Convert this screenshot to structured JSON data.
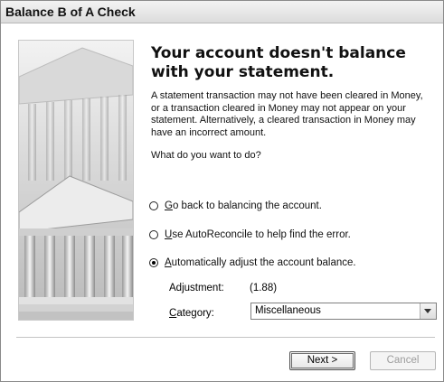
{
  "window": {
    "title": "Balance B of A Check"
  },
  "header": {
    "heading": "Your account doesn't balance with your statement."
  },
  "body": {
    "description": "A statement transaction may not have been cleared in Money, or a transaction cleared in Money may not appear on your statement. Alternatively, a cleared transaction in Money may have an incorrect amount.",
    "question": "What do you want to do?"
  },
  "options": [
    {
      "mnemonic": "G",
      "rest": "o back to balancing the account.",
      "selected": false
    },
    {
      "mnemonic": "U",
      "rest": "se AutoReconcile to help find the error.",
      "selected": false
    },
    {
      "mnemonic": "A",
      "rest": "utomatically adjust the account balance.",
      "selected": true
    }
  ],
  "adjustment": {
    "label": "Adjustment:",
    "value": "(1.88)"
  },
  "category": {
    "label_mnemonic": "C",
    "label_rest": "ategory:",
    "value": "Miscellaneous"
  },
  "buttons": {
    "next": "Next >",
    "cancel": "Cancel"
  },
  "icons": {
    "illustration": "bank-building-illustration",
    "dropdown": "chevron-down-icon"
  }
}
